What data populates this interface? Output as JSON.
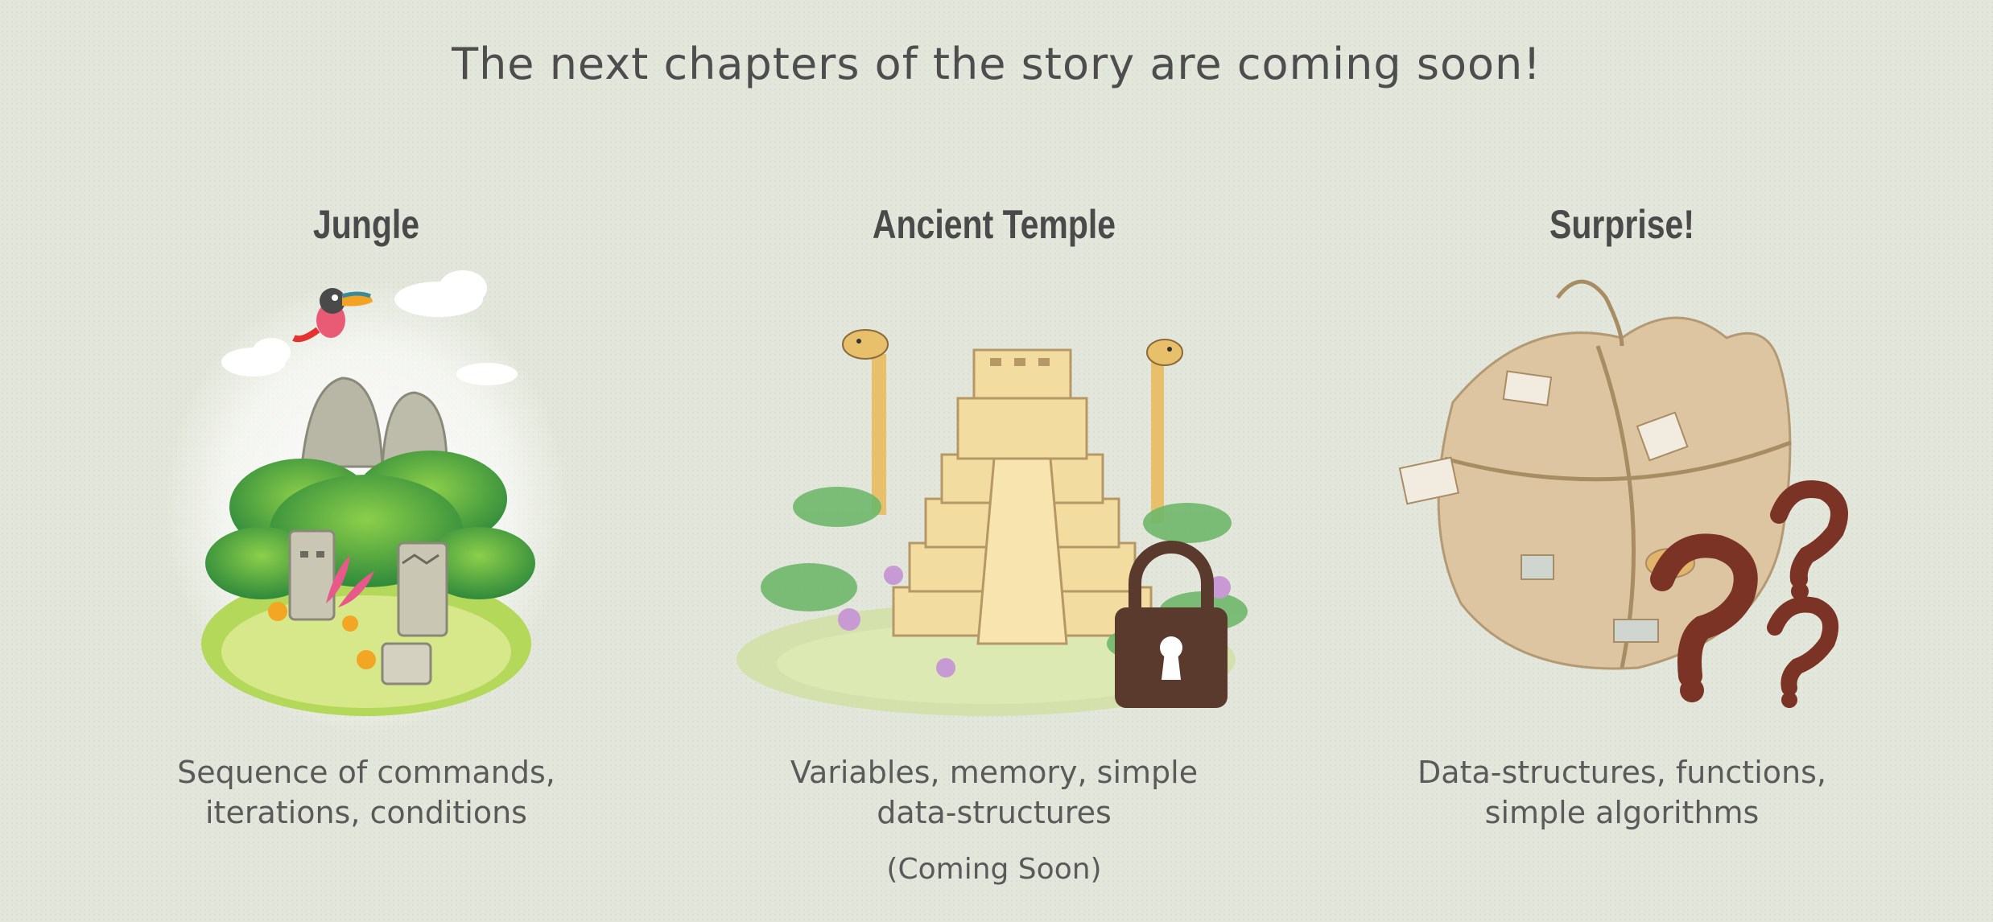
{
  "headline": "The next chapters of the story are coming soon!",
  "chapters": [
    {
      "title": "Jungle",
      "description": "Sequence of commands, iterations, conditions",
      "illustration": "jungle-island-illustration",
      "locked": false
    },
    {
      "title": "Ancient Temple",
      "description": "Variables, memory, simple data-structures",
      "note": "(Coming Soon)",
      "illustration": "temple-illustration",
      "locked": true
    },
    {
      "title": "Surprise!",
      "description": "Data-structures, functions, simple algorithms",
      "illustration": "mystery-sack-illustration",
      "locked": false
    }
  ],
  "colors": {
    "background": "#e3e7db",
    "text": "#4d4d4d",
    "lock": "#5b3a2e",
    "question_mark": "#7a3324"
  }
}
